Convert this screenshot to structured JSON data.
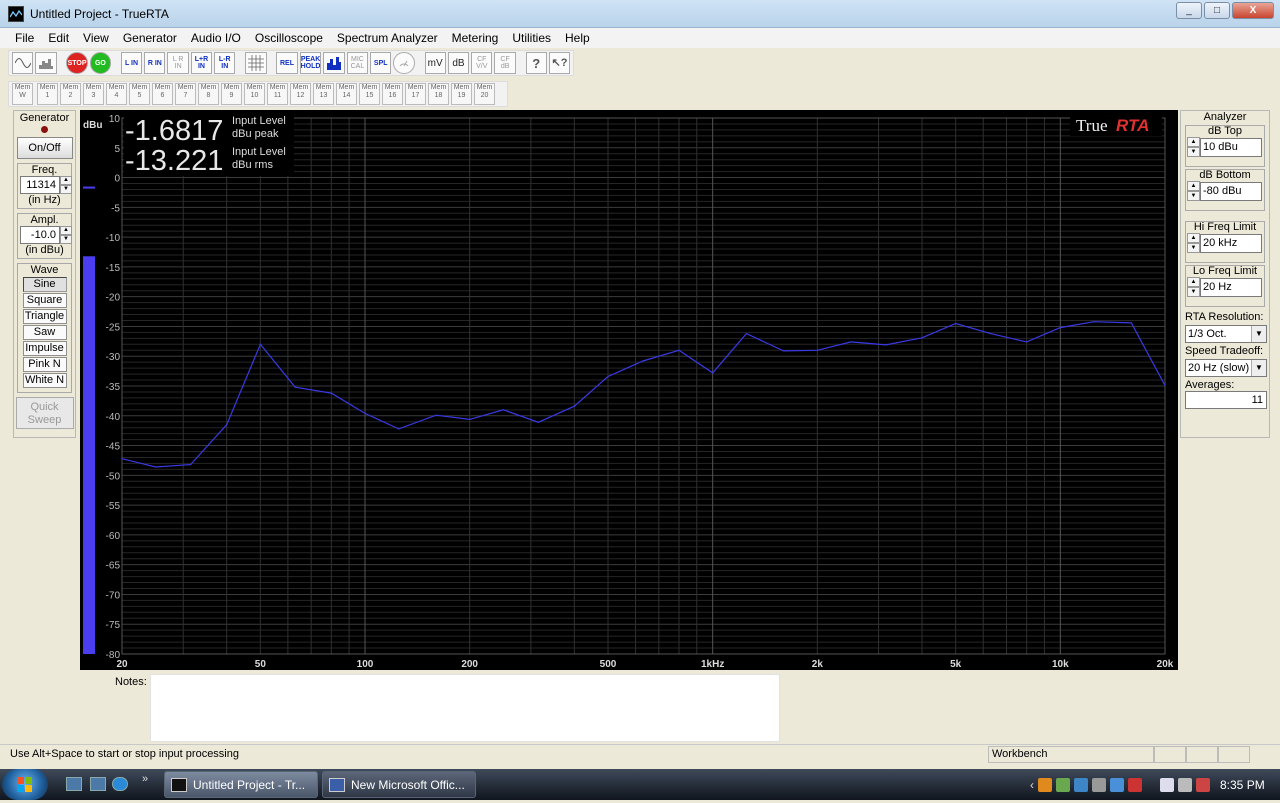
{
  "window": {
    "title": "Untitled Project - TrueRTA",
    "min": "_",
    "max": "□",
    "close": "X"
  },
  "menu": [
    "File",
    "Edit",
    "View",
    "Generator",
    "Audio I/O",
    "Oscilloscope",
    "Spectrum Analyzer",
    "Metering",
    "Utilities",
    "Help"
  ],
  "toolbar": {
    "buttons": [
      "STOP",
      "GO",
      "L IN",
      "R IN",
      "L R IN",
      "L+R IN",
      "L-R IN",
      "REL",
      "PEAK HOLD",
      "MIC CAL",
      "SPL",
      "mV",
      "dB",
      "CF V/V",
      "CF dB"
    ],
    "mem": [
      "Mem W",
      "Mem 1",
      "Mem 2",
      "Mem 3",
      "Mem 4",
      "Mem 5",
      "Mem 6",
      "Mem 7",
      "Mem 8",
      "Mem 9",
      "Mem 10",
      "Mem 11",
      "Mem 12",
      "Mem 13",
      "Mem 14",
      "Mem 15",
      "Mem 16",
      "Mem 17",
      "Mem 18",
      "Mem 19",
      "Mem 20"
    ]
  },
  "generator": {
    "title": "Generator",
    "onoff": "On/Off",
    "freq_label": "Freq.",
    "freq_value": "11314",
    "freq_unit": "(in Hz)",
    "ampl_label": "Ampl.",
    "ampl_value": "-10.0",
    "ampl_unit": "(in dBu)",
    "wave_label": "Wave",
    "waves": [
      "Sine",
      "Square",
      "Triangle",
      "Saw",
      "Impulse",
      "Pink N",
      "White N"
    ],
    "quick_sweep": "Quick Sweep"
  },
  "readout": {
    "peak_value": "-1.6817",
    "peak_l1": "Input Level",
    "peak_l2": "dBu peak",
    "rms_value": "-13.221",
    "rms_l1": "Input Level",
    "rms_l2": "dBu rms",
    "unit": "dBu",
    "brand_true": "True",
    "brand_rta": "RTA"
  },
  "analyzer": {
    "title": "Analyzer",
    "db_top_label": "dB Top",
    "db_top": "10 dBu",
    "db_bottom_label": "dB Bottom",
    "db_bottom": "-80 dBu",
    "hi_label": "Hi Freq Limit",
    "hi": "20 kHz",
    "lo_label": "Lo Freq Limit",
    "lo": "20 Hz",
    "res_label": "RTA Resolution:",
    "res": "1/3 Oct.",
    "speed_label": "Speed Tradeoff:",
    "speed": "20 Hz (slow)",
    "avg_label": "Averages:",
    "avg": "11"
  },
  "chart_data": {
    "type": "line",
    "xscale": "log",
    "xlim": [
      20,
      20000
    ],
    "ylim": [
      -80,
      10
    ],
    "yticks": [
      10,
      5,
      0,
      -5,
      -10,
      -15,
      -20,
      -25,
      -30,
      -35,
      -40,
      -45,
      -50,
      -55,
      -60,
      -65,
      -70,
      -75,
      -80
    ],
    "xticks": [
      {
        "v": 20,
        "l": "20"
      },
      {
        "v": 50,
        "l": "50"
      },
      {
        "v": 100,
        "l": "100"
      },
      {
        "v": 200,
        "l": "200"
      },
      {
        "v": 500,
        "l": "500"
      },
      {
        "v": 1000,
        "l": "1kHz"
      },
      {
        "v": 2000,
        "l": "2k"
      },
      {
        "v": 5000,
        "l": "5k"
      },
      {
        "v": 10000,
        "l": "10k"
      },
      {
        "v": 20000,
        "l": "20k"
      }
    ],
    "series": [
      {
        "color": "#3a3ae6",
        "x": [
          20,
          25,
          31.5,
          40,
          50,
          63,
          80,
          100,
          125,
          160,
          200,
          250,
          315,
          400,
          500,
          630,
          800,
          1000,
          1250,
          1600,
          2000,
          2500,
          3150,
          4000,
          5000,
          6300,
          8000,
          10000,
          12500,
          16000,
          20000
        ],
        "y": [
          -47.2,
          -48.6,
          -48.2,
          -41.5,
          -28.0,
          -35.2,
          -36.2,
          -39.6,
          -42.2,
          -39.9,
          -40.6,
          -39.0,
          -41.1,
          -38.4,
          -33.4,
          -30.8,
          -29.0,
          -32.8,
          -26.2,
          -29.1,
          -29.0,
          -27.6,
          -28.1,
          -26.9,
          -24.5,
          -26.2,
          -27.6,
          -25.2,
          -24.2,
          -24.4,
          -34.9
        ]
      }
    ],
    "level_meter": {
      "rms": -13.221,
      "peak": -1.6817
    }
  },
  "notes": {
    "label": "Notes:",
    "text": ""
  },
  "status": {
    "hint": "Use Alt+Space to start or stop input processing",
    "mode": "Workbench"
  },
  "taskbar": {
    "tasks": [
      "Untitled Project - Tr...",
      "New Microsoft Offic..."
    ],
    "time": "8:35 PM"
  }
}
